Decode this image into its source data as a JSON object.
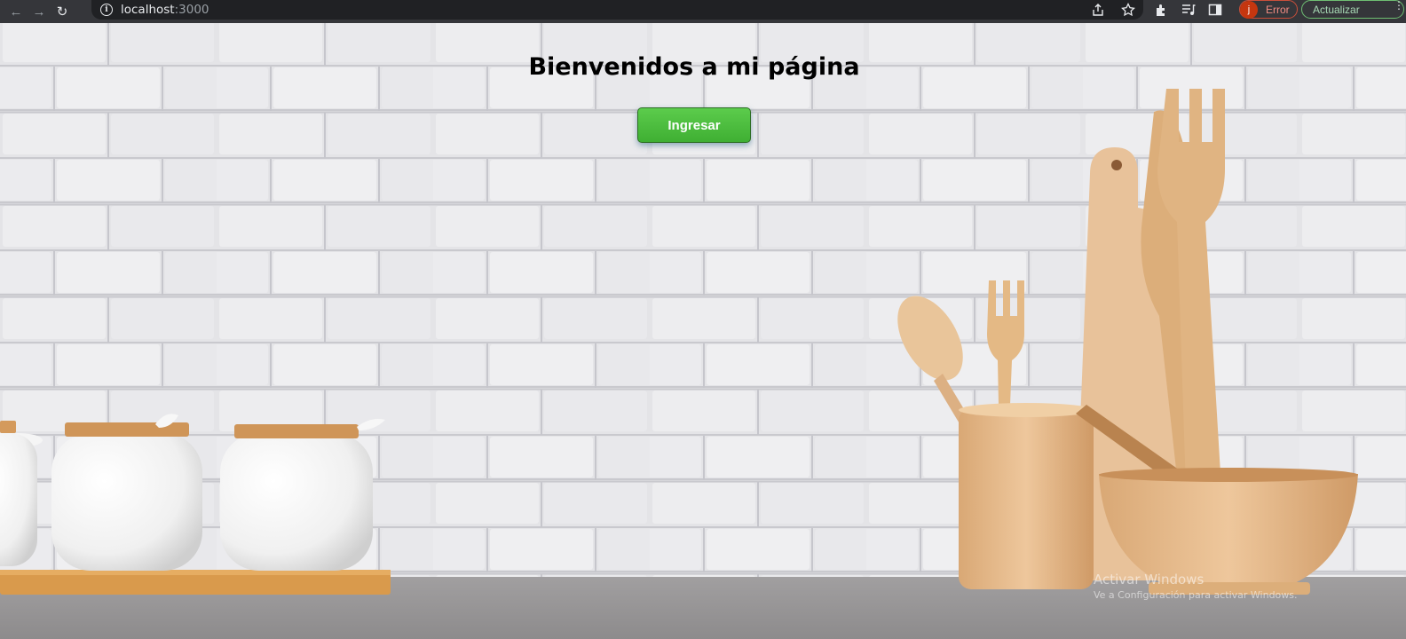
{
  "browser": {
    "url_host": "localhost",
    "url_port": ":3000",
    "profile_initial": "j",
    "profile_status": "Error",
    "update_label": "Actualizar",
    "icons": [
      "back-icon",
      "forward-icon",
      "reload-icon",
      "info-icon",
      "share-icon",
      "star-icon",
      "extensions-icon",
      "media-icon",
      "side-panel-icon",
      "menu-icon"
    ]
  },
  "page": {
    "title": "Bienvenidos a mi página",
    "enter_button": "Ingresar",
    "button_color": "#4cbf3f"
  },
  "watermark": {
    "line1": "Activar Windows",
    "line2": "Ve a Configuración para activar Windows."
  }
}
